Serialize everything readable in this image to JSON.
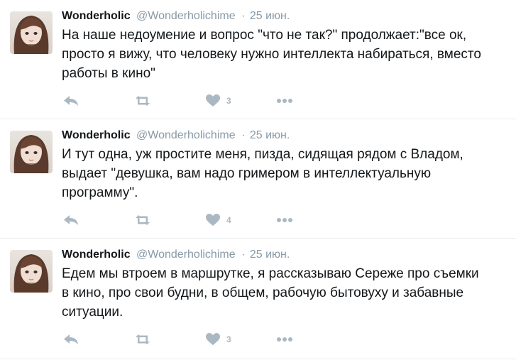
{
  "tweets": [
    {
      "name": "Wonderholic",
      "handle": "@Wonderholichime",
      "separator": "·",
      "time": "25 июн.",
      "text": "На наше недоумение и вопрос \"что не так?\" продолжает:\"все ок,\nпросто я вижу, что человеку нужно интеллекта набираться, вместо\nработы в кино\"",
      "likes": "3"
    },
    {
      "name": "Wonderholic",
      "handle": "@Wonderholichime",
      "separator": "·",
      "time": "25 июн.",
      "text": "И тут одна, уж простите меня, пизда, сидящая рядом с Владом,\nвыдает \"девушка, вам надо гримером в интеллектуальную\nпрограмму\".",
      "likes": "4"
    },
    {
      "name": "Wonderholic",
      "handle": "@Wonderholichime",
      "separator": "·",
      "time": "25 июн.",
      "text": "Едем мы втроем в маршрутке, я рассказываю Сереже про съемки\nв кино, про свои будни, в общем, рабочую бытовуху и забавные\nситуации.",
      "likes": "3"
    }
  ],
  "icons": {
    "reply": "reply-icon",
    "retweet": "retweet-icon",
    "like": "heart-icon",
    "more": "more-dots-icon"
  },
  "colors": {
    "name": "#14171a",
    "meta": "#8899a6",
    "action": "#aab8c2",
    "divider": "#e6ecf0"
  }
}
